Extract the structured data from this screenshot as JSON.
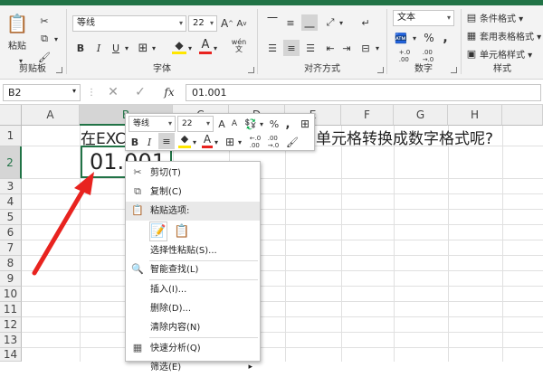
{
  "ribbon": {
    "clipboard": {
      "group_label": "剪贴板",
      "paste_label": "粘贴"
    },
    "font": {
      "group_label": "字体",
      "font_name": "等线",
      "font_size": "22",
      "grow": "A",
      "shrink": "A",
      "wen": "wén",
      "bold": "B",
      "italic": "I",
      "underline": "U",
      "font_color_letter": "A"
    },
    "alignment": {
      "group_label": "对齐方式"
    },
    "number": {
      "group_label": "数字",
      "format": "文本",
      "percent": "%",
      "comma": ",",
      "inc_decimal": "+.0\n.00",
      "dec_decimal": ".00\n→.0"
    },
    "styles": {
      "group_label": "样式",
      "conditional": "条件格式 ▾",
      "table": "套用表格格式 ▾",
      "cell_styles": "单元格样式 ▾"
    }
  },
  "formula_bar": {
    "name_box": "B2",
    "fx": "fx",
    "value": "01.001"
  },
  "grid": {
    "columns": [
      "A",
      "B",
      "C",
      "D",
      "E",
      "F",
      "G",
      "H"
    ],
    "rows": [
      "1",
      "2",
      "3",
      "4",
      "5",
      "6",
      "7",
      "8",
      "9",
      "10",
      "11",
      "12",
      "13",
      "14"
    ],
    "a1_left": "在EXC",
    "a1_right": "单元格转换成数字格式呢?",
    "b2_value": "01.001"
  },
  "mini_toolbar": {
    "font_name": "等线",
    "font_size": "22",
    "grow": "A",
    "shrink": "A",
    "percent": "%",
    "comma": ",",
    "bold": "B",
    "italic": "I",
    "font_color_letter": "A",
    "inc_decimal": "←.0\n.00",
    "dec_decimal": ".00\n→.0"
  },
  "context_menu": {
    "items": [
      {
        "label": "剪切(T)"
      },
      {
        "label": "复制(C)"
      },
      {
        "label": "粘贴选项:"
      },
      {
        "label": "选择性粘贴(S)..."
      },
      {
        "label": "智能查找(L)"
      },
      {
        "label": "插入(I)..."
      },
      {
        "label": "删除(D)..."
      },
      {
        "label": "清除内容(N)"
      },
      {
        "label": "快速分析(Q)"
      },
      {
        "label": "筛选(E)"
      }
    ]
  },
  "colors": {
    "excel_green": "#217346",
    "arrow_red": "#e8231f"
  }
}
